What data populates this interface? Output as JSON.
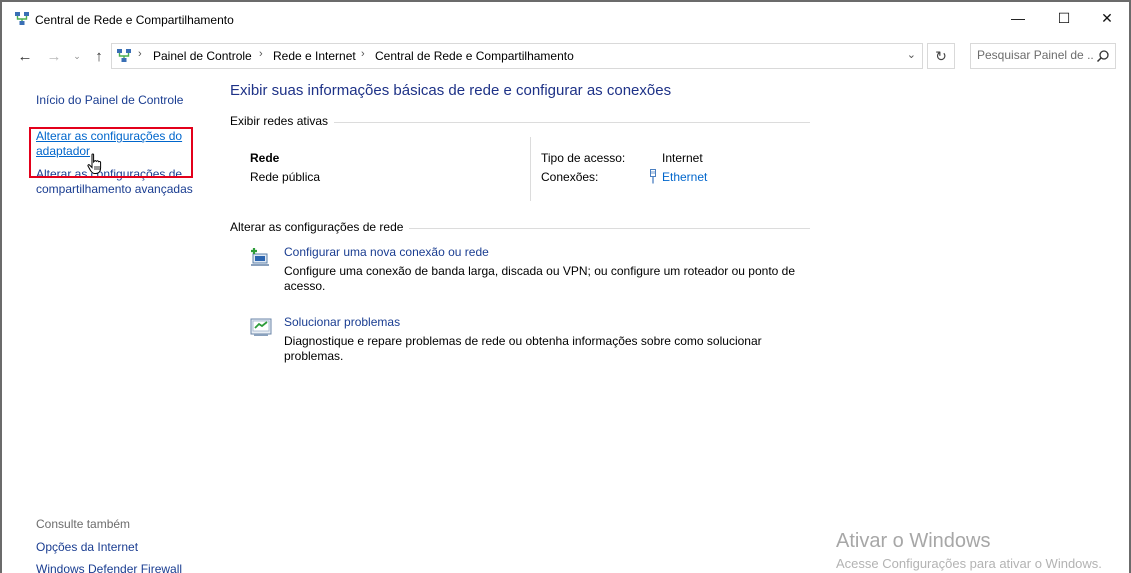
{
  "window": {
    "title": "Central de Rede e Compartilhamento",
    "minimize_glyph": "—",
    "maximize_glyph": "☐",
    "close_glyph": "✕"
  },
  "nav": {
    "back_glyph": "←",
    "forward_glyph": "→",
    "recent_glyph": "⌄",
    "up_glyph": "↑",
    "breadcrumbs": [
      "Painel de Controle",
      "Rede e Internet",
      "Central de Rede e Compartilhamento"
    ],
    "separator": "›",
    "dropdown_glyph": "⌄",
    "refresh_glyph": "↻",
    "search_placeholder": "Pesquisar Painel de ..."
  },
  "sidebar": {
    "home": "Início do Painel de Controle",
    "adapter": "Alterar as configurações do adaptador",
    "sharing": "Alterar as configurações de compartilhamento avançadas",
    "see_also": "Consulte também",
    "internet_options": "Opções da Internet",
    "firewall": "Windows Defender Firewall"
  },
  "main": {
    "title": "Exibir suas informações básicas de rede e configurar as conexões",
    "active_networks_header": "Exibir redes ativas",
    "network": {
      "name": "Rede",
      "type": "Rede pública",
      "access_label": "Tipo de acesso:",
      "access_value": "Internet",
      "connections_label": "Conexões:",
      "connections_value": "Ethernet"
    },
    "change_header": "Alterar as configurações de rede",
    "tasks": [
      {
        "link": "Configurar uma nova conexão ou rede",
        "desc": "Configure uma conexão de banda larga, discada ou VPN; ou configure um roteador ou ponto de acesso."
      },
      {
        "link": "Solucionar problemas",
        "desc": "Diagnostique e repare problemas de rede ou obtenha informações sobre como solucionar problemas."
      }
    ]
  },
  "watermark": {
    "title": "Ativar o Windows",
    "subtitle": "Acesse Configurações para ativar o Windows."
  },
  "colors": {
    "link": "#1a3d91",
    "link_hover": "#0066cc",
    "title": "#1e3287",
    "highlight": "#e3001b"
  },
  "icons": {
    "app": "network-center-icon",
    "address": "network-center-icon",
    "search": "search-icon",
    "ethernet": "ethernet-icon",
    "new_connection": "new-connection-icon",
    "troubleshoot": "troubleshoot-icon",
    "cursor": "hand-cursor-icon"
  }
}
